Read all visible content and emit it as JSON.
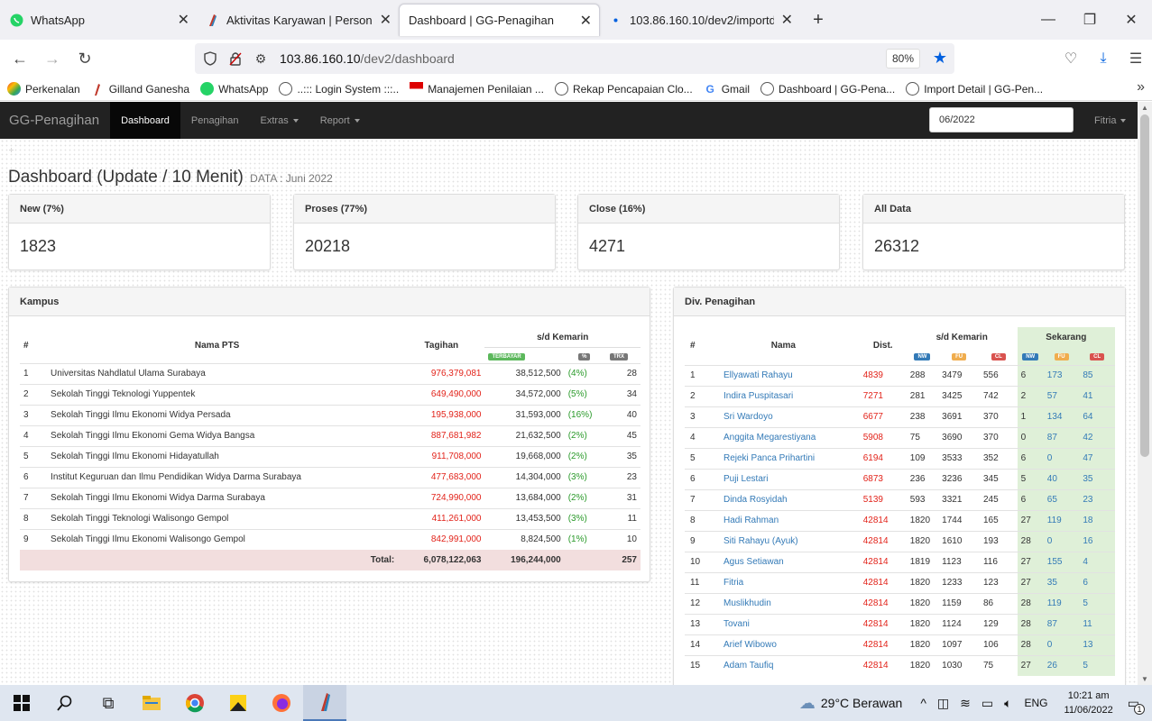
{
  "browser": {
    "tabs": [
      {
        "label": "WhatsApp",
        "active": false
      },
      {
        "label": "Aktivitas Karyawan | Personalia",
        "active": false
      },
      {
        "label": "Dashboard | GG-Penagihan",
        "active": true
      },
      {
        "label": "103.86.160.10/dev2/importdetail",
        "active": false
      }
    ],
    "url_host": "103.86.160.10",
    "url_path": "/dev2/dashboard",
    "zoom": "80%",
    "bookmarks": [
      "Perkenalan",
      "Gilland Ganesha",
      "WhatsApp",
      "..::: Login System :::..",
      "Manajemen Penilaian ...",
      "Rekap Pencapaian Clo...",
      "Gmail",
      "Dashboard | GG-Pena...",
      "Import Detail | GG-Pen..."
    ]
  },
  "app": {
    "brand": "GG-Penagihan",
    "nav": [
      "Dashboard",
      "Penagihan",
      "Extras",
      "Report"
    ],
    "period": "06/2022",
    "user": "Fitria"
  },
  "page": {
    "title": "Dashboard (Update / 10 Menit)",
    "subtitle": "DATA : Juni 2022"
  },
  "stats": [
    {
      "label": "New (7%)",
      "value": "1823"
    },
    {
      "label": "Proses (77%)",
      "value": "20218"
    },
    {
      "label": "Close (16%)",
      "value": "4271"
    },
    {
      "label": "All Data",
      "value": "26312"
    }
  ],
  "kampus": {
    "title": "Kampus",
    "headers": {
      "no": "#",
      "name": "Nama PTS",
      "tagihan": "Tagihan",
      "group": "s/d Kemarin",
      "terbayar": "TERBAYAR",
      "pct": "%",
      "trx": "TRX"
    },
    "rows": [
      {
        "no": "1",
        "name": "Universitas Nahdlatul Ulama Surabaya",
        "tagihan": "976,379,081",
        "terbayar": "38,512,500",
        "pct": "(4%)",
        "trx": "28"
      },
      {
        "no": "2",
        "name": "Sekolah Tinggi Teknologi Yuppentek",
        "tagihan": "649,490,000",
        "terbayar": "34,572,000",
        "pct": "(5%)",
        "trx": "34"
      },
      {
        "no": "3",
        "name": "Sekolah Tinggi Ilmu Ekonomi Widya Persada",
        "tagihan": "195,938,000",
        "terbayar": "31,593,000",
        "pct": "(16%)",
        "trx": "40"
      },
      {
        "no": "4",
        "name": "Sekolah Tinggi Ilmu Ekonomi Gema Widya Bangsa",
        "tagihan": "887,681,982",
        "terbayar": "21,632,500",
        "pct": "(2%)",
        "trx": "45"
      },
      {
        "no": "5",
        "name": "Sekolah Tinggi Ilmu Ekonomi Hidayatullah",
        "tagihan": "911,708,000",
        "terbayar": "19,668,000",
        "pct": "(2%)",
        "trx": "35"
      },
      {
        "no": "6",
        "name": "Institut Keguruan dan Ilmu Pendidikan Widya Darma Surabaya",
        "tagihan": "477,683,000",
        "terbayar": "14,304,000",
        "pct": "(3%)",
        "trx": "23"
      },
      {
        "no": "7",
        "name": "Sekolah Tinggi Ilmu Ekonomi Widya Darma Surabaya",
        "tagihan": "724,990,000",
        "terbayar": "13,684,000",
        "pct": "(2%)",
        "trx": "31"
      },
      {
        "no": "8",
        "name": "Sekolah Tinggi Teknologi Walisongo Gempol",
        "tagihan": "411,261,000",
        "terbayar": "13,453,500",
        "pct": "(3%)",
        "trx": "11"
      },
      {
        "no": "9",
        "name": "Sekolah Tinggi Ilmu Ekonomi Walisongo Gempol",
        "tagihan": "842,991,000",
        "terbayar": "8,824,500",
        "pct": "(1%)",
        "trx": "10"
      }
    ],
    "total_label": "Total:",
    "total_tagihan": "6,078,122,063",
    "total_terbayar": "196,244,000",
    "total_trx": "257"
  },
  "divisi": {
    "title": "Div. Penagihan",
    "headers": {
      "no": "#",
      "name": "Nama",
      "dist": "Dist.",
      "group1": "s/d Kemarin",
      "group2": "Sekarang",
      "nw": "NW",
      "fu": "FU",
      "cl": "CL"
    },
    "rows": [
      {
        "no": "1",
        "name": "Ellyawati Rahayu",
        "dist": "4839",
        "nw": "288",
        "fu": "3479",
        "cl": "556",
        "snw": "6",
        "sfu": "173",
        "scl": "85"
      },
      {
        "no": "2",
        "name": "Indira Puspitasari",
        "dist": "7271",
        "nw": "281",
        "fu": "3425",
        "cl": "742",
        "snw": "2",
        "sfu": "57",
        "scl": "41"
      },
      {
        "no": "3",
        "name": "Sri Wardoyo",
        "dist": "6677",
        "nw": "238",
        "fu": "3691",
        "cl": "370",
        "snw": "1",
        "sfu": "134",
        "scl": "64"
      },
      {
        "no": "4",
        "name": "Anggita Megarestiyana",
        "dist": "5908",
        "nw": "75",
        "fu": "3690",
        "cl": "370",
        "snw": "0",
        "sfu": "87",
        "scl": "42"
      },
      {
        "no": "5",
        "name": "Rejeki Panca Prihartini",
        "dist": "6194",
        "nw": "109",
        "fu": "3533",
        "cl": "352",
        "snw": "6",
        "sfu": "0",
        "scl": "47"
      },
      {
        "no": "6",
        "name": "Puji Lestari",
        "dist": "6873",
        "nw": "236",
        "fu": "3236",
        "cl": "345",
        "snw": "5",
        "sfu": "40",
        "scl": "35"
      },
      {
        "no": "7",
        "name": "Dinda Rosyidah",
        "dist": "5139",
        "nw": "593",
        "fu": "3321",
        "cl": "245",
        "snw": "6",
        "sfu": "65",
        "scl": "23"
      },
      {
        "no": "8",
        "name": "Hadi Rahman",
        "dist": "42814",
        "nw": "1820",
        "fu": "1744",
        "cl": "165",
        "snw": "27",
        "sfu": "119",
        "scl": "18"
      },
      {
        "no": "9",
        "name": "Siti Rahayu (Ayuk)",
        "dist": "42814",
        "nw": "1820",
        "fu": "1610",
        "cl": "193",
        "snw": "28",
        "sfu": "0",
        "scl": "16"
      },
      {
        "no": "10",
        "name": "Agus Setiawan",
        "dist": "42814",
        "nw": "1819",
        "fu": "1123",
        "cl": "116",
        "snw": "27",
        "sfu": "155",
        "scl": "4"
      },
      {
        "no": "11",
        "name": "Fitria",
        "dist": "42814",
        "nw": "1820",
        "fu": "1233",
        "cl": "123",
        "snw": "27",
        "sfu": "35",
        "scl": "6"
      },
      {
        "no": "12",
        "name": "Muslikhudin",
        "dist": "42814",
        "nw": "1820",
        "fu": "1159",
        "cl": "86",
        "snw": "28",
        "sfu": "119",
        "scl": "5"
      },
      {
        "no": "13",
        "name": "Tovani",
        "dist": "42814",
        "nw": "1820",
        "fu": "1124",
        "cl": "129",
        "snw": "28",
        "sfu": "87",
        "scl": "11"
      },
      {
        "no": "14",
        "name": "Arief Wibowo",
        "dist": "42814",
        "nw": "1820",
        "fu": "1097",
        "cl": "106",
        "snw": "28",
        "sfu": "0",
        "scl": "13"
      },
      {
        "no": "15",
        "name": "Adam Taufiq",
        "dist": "42814",
        "nw": "1820",
        "fu": "1030",
        "cl": "75",
        "snw": "27",
        "sfu": "26",
        "scl": "5"
      }
    ]
  },
  "taskbar": {
    "weather": "29°C  Berawan",
    "lang": "ENG",
    "time": "10:21 am",
    "date": "11/06/2022",
    "notif_count": "1"
  }
}
